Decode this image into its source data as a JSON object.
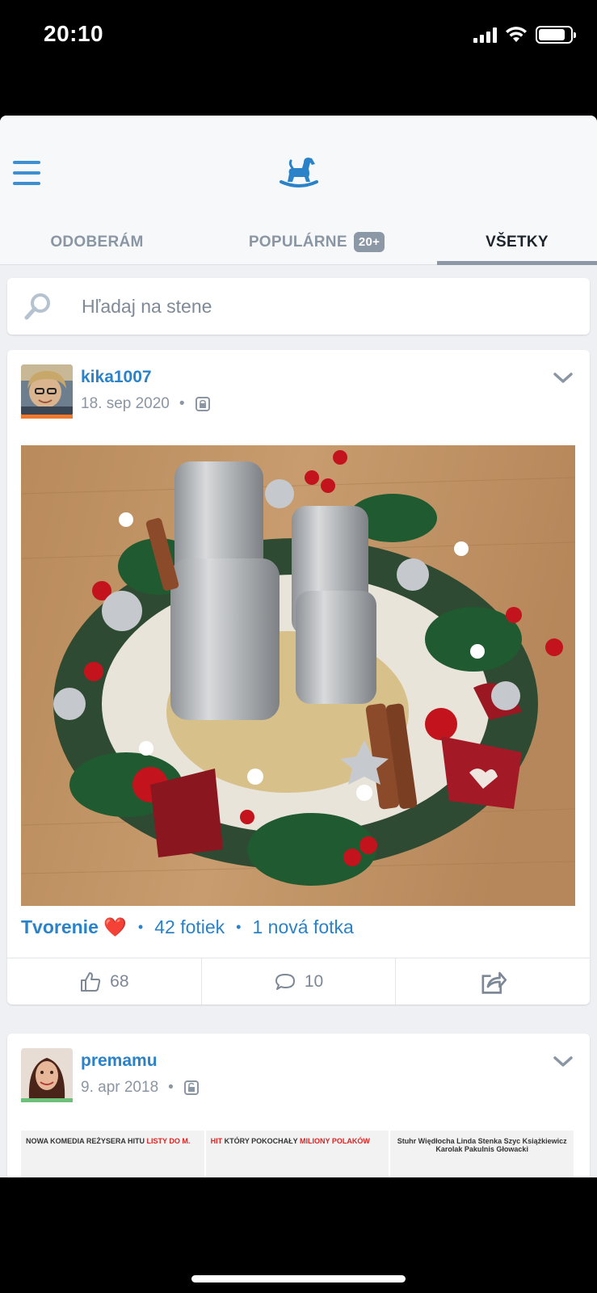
{
  "status_bar": {
    "time": "20:10"
  },
  "header": {
    "logo": "rocking-horse-logo",
    "tabs": [
      {
        "label": "ODOBERÁM"
      },
      {
        "label": "POPULÁRNE",
        "badge": "20+"
      },
      {
        "label": "VŠETKY",
        "active": true
      }
    ]
  },
  "search": {
    "placeholder": "Hľadaj na stene"
  },
  "posts": [
    {
      "author": "kika1007",
      "date": "18. sep 2020",
      "album_title": "Tvorenie",
      "album_emoji": "❤️",
      "photos_count": "42 fotiek",
      "new_photos": "1 nová fotka",
      "likes": "68",
      "comments": "10",
      "avatar_bar_color": "#f0782d"
    },
    {
      "author": "premamu",
      "date": "9. apr 2018",
      "avatar_bar_color": "#6cc07a",
      "poster_texts": [
        {
          "plain": "NOWA KOMEDIA REŻYSERA HITU ",
          "red": "LISTY DO M."
        },
        {
          "red": "HIT ",
          "plain": "KTÓRY POKOCHAŁY ",
          "red2": "MILIONY POLAKÓW"
        },
        {
          "plain": "Stuhr Więdłocha Linda Stenka Szyc Książkiewicz Karolak Pakulnis Głowacki"
        }
      ]
    }
  ],
  "colors": {
    "accent": "#2a82c9",
    "muted": "#8a96a3",
    "background": "#eef0f3"
  }
}
